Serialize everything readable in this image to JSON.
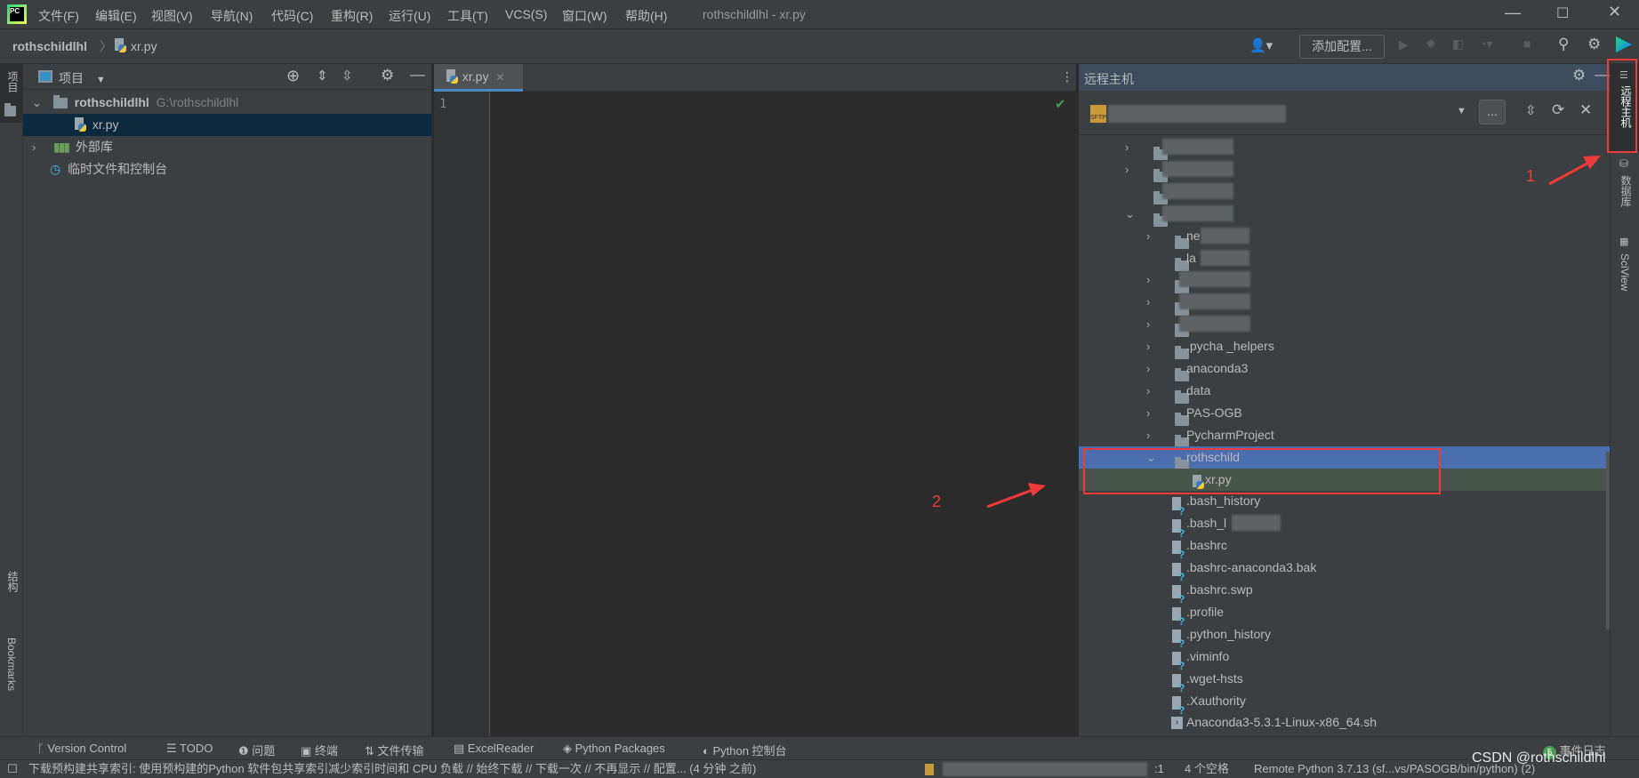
{
  "menubar": {
    "items": [
      "文件(F)",
      "编辑(E)",
      "视图(V)",
      "导航(N)",
      "代码(C)",
      "重构(R)",
      "运行(U)",
      "工具(T)",
      "VCS(S)",
      "窗口(W)",
      "帮助(H)"
    ],
    "window_title": "rothschildlhl - xr.py"
  },
  "navbar": {
    "breadcrumb": [
      "rothschildlhl",
      "xr.py"
    ],
    "add_config": "添加配置..."
  },
  "left_strip": {
    "project": "项目",
    "structure": "结构",
    "bookmarks": "Bookmarks"
  },
  "project_panel": {
    "title": "项目",
    "root_name": "rothschildlhl",
    "root_path": "G:\\rothschildlhl",
    "file": "xr.py",
    "external_libs": "外部库",
    "scratches": "临时文件和控制台"
  },
  "editor": {
    "tab": "xr.py",
    "line_number": "1",
    "status_color": "#499c54"
  },
  "remote_panel": {
    "title": "远程主机",
    "browse_button": "...",
    "tree": [
      {
        "level": 1,
        "type": "folder",
        "expand": ">",
        "visible": "",
        "blur": true
      },
      {
        "level": 1,
        "type": "folder",
        "expand": ">",
        "visible": "",
        "blur": true
      },
      {
        "level": 1,
        "type": "folder",
        "expand": "",
        "visible": "",
        "blur": true
      },
      {
        "level": 1,
        "type": "folder",
        "expand": "v",
        "visible": "",
        "blur": true
      },
      {
        "level": 2,
        "type": "folder",
        "expand": ">",
        "visible": "ne",
        "blur": true
      },
      {
        "level": 2,
        "type": "folder",
        "expand": "",
        "visible": "la",
        "blur": true
      },
      {
        "level": 2,
        "type": "folder",
        "expand": ">",
        "visible": "",
        "blur": true
      },
      {
        "level": 2,
        "type": "folder",
        "expand": ">",
        "visible": "",
        "blur": true
      },
      {
        "level": 2,
        "type": "folder",
        "expand": ">",
        "visible": "",
        "blur": true
      },
      {
        "level": 2,
        "type": "folder",
        "expand": ">",
        "visible": ".pycha _helpers",
        "blur": false
      },
      {
        "level": 2,
        "type": "folder",
        "expand": ">",
        "visible": "anaconda3",
        "blur": false
      },
      {
        "level": 2,
        "type": "folder",
        "expand": ">",
        "visible": "data",
        "blur": false
      },
      {
        "level": 2,
        "type": "folder",
        "expand": ">",
        "visible": "PAS-OGB",
        "blur": false
      },
      {
        "level": 2,
        "type": "folder",
        "expand": ">",
        "visible": "PycharmProject",
        "blur": false
      },
      {
        "level": 2,
        "type": "folder",
        "expand": "v",
        "visible": "rothschild",
        "blur": false,
        "selected": true
      },
      {
        "level": 3,
        "type": "py",
        "expand": "",
        "visible": "xr.py",
        "blur": false,
        "highlight": true
      },
      {
        "level": 2,
        "type": "file",
        "expand": "",
        "visible": ".bash_history",
        "blur": false
      },
      {
        "level": 2,
        "type": "file",
        "expand": "",
        "visible": ".bash_l",
        "blur": true
      },
      {
        "level": 2,
        "type": "file",
        "expand": "",
        "visible": ".bashrc",
        "blur": false
      },
      {
        "level": 2,
        "type": "file",
        "expand": "",
        "visible": ".bashrc-anaconda3.bak",
        "blur": false
      },
      {
        "level": 2,
        "type": "file",
        "expand": "",
        "visible": ".bashrc.swp",
        "blur": false
      },
      {
        "level": 2,
        "type": "file",
        "expand": "",
        "visible": ".profile",
        "blur": false
      },
      {
        "level": 2,
        "type": "file",
        "expand": "",
        "visible": ".python_history",
        "blur": false
      },
      {
        "level": 2,
        "type": "file",
        "expand": "",
        "visible": ".viminfo",
        "blur": false
      },
      {
        "level": 2,
        "type": "file",
        "expand": "",
        "visible": ".wget-hsts",
        "blur": false
      },
      {
        "level": 2,
        "type": "file",
        "expand": "",
        "visible": ".Xauthority",
        "blur": false
      },
      {
        "level": 2,
        "type": "sh",
        "expand": "",
        "visible": "Anaconda3-5.3.1-Linux-x86_64.sh",
        "blur": false
      }
    ]
  },
  "right_strip": {
    "remote_host": "远程主机",
    "database": "数据库",
    "sciview": "SciView"
  },
  "tool_windows": [
    "Version Control",
    "TODO",
    "问题",
    "终端",
    "文件传输",
    "ExcelReader",
    "Python Packages",
    "Python 控制台"
  ],
  "event_log": {
    "count": "5",
    "label": "事件日志"
  },
  "status": {
    "message": "下载预构建共享索引: 使用预构建的Python 软件包共享索引减少索引时间和 CPU 负载 // 始终下载 // 下载一次 // 不再显示 // 配置... (4 分钟 之前)",
    "position": ":1",
    "indent": "4 个空格",
    "interpreter": "Remote Python 3.7.13 (sf...vs/PASOGB/bin/python) (2)"
  },
  "annotations": {
    "label1": "1",
    "label2": "2",
    "color": "#f03a3a"
  },
  "watermark": "CSDN @rothschildlhl"
}
